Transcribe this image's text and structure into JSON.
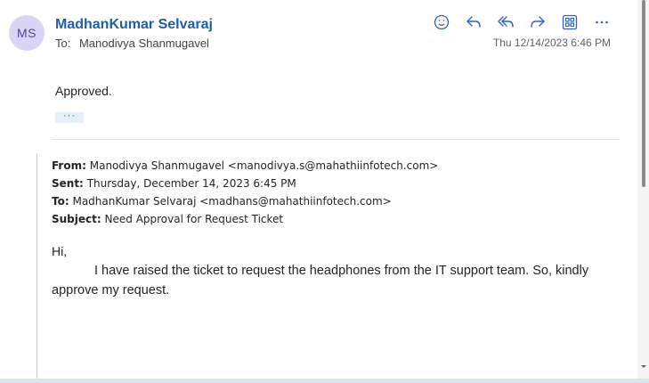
{
  "message": {
    "avatar_initials": "MS",
    "sender_name": "MadhanKumar Selvaraj",
    "to_label": "To:",
    "to_name": "Manodivya Shanmugavel",
    "date": "Thu 12/14/2023 6:46 PM",
    "body_text": "Approved.",
    "ellipsis": "···"
  },
  "actions": [
    {
      "icon": "emoji-icon"
    },
    {
      "icon": "reply-icon"
    },
    {
      "icon": "reply-all-icon"
    },
    {
      "icon": "forward-icon"
    },
    {
      "icon": "apps-icon"
    },
    {
      "icon": "more-icon"
    }
  ],
  "quoted": {
    "from_label": "From:",
    "from_value": "Manodivya Shanmugavel <manodivya.s@mahathiinfotech.com>",
    "sent_label": "Sent:",
    "sent_value": "Thursday, December 14, 2023 6:45 PM",
    "to_label": "To:",
    "to_value": "MadhanKumar Selvaraj <madhans@mahathiinfotech.com>",
    "subject_label": "Subject:",
    "subject_value": "Need Approval for Request Ticket",
    "greeting": "Hi,",
    "paragraph": "I have raised the ticket to request the headphones from the IT support team. So, kindly approve my request."
  },
  "colors": {
    "accent": "#2d63b8",
    "sender": "#1f5fa8",
    "avatar_bg": "#d9d6f5"
  }
}
